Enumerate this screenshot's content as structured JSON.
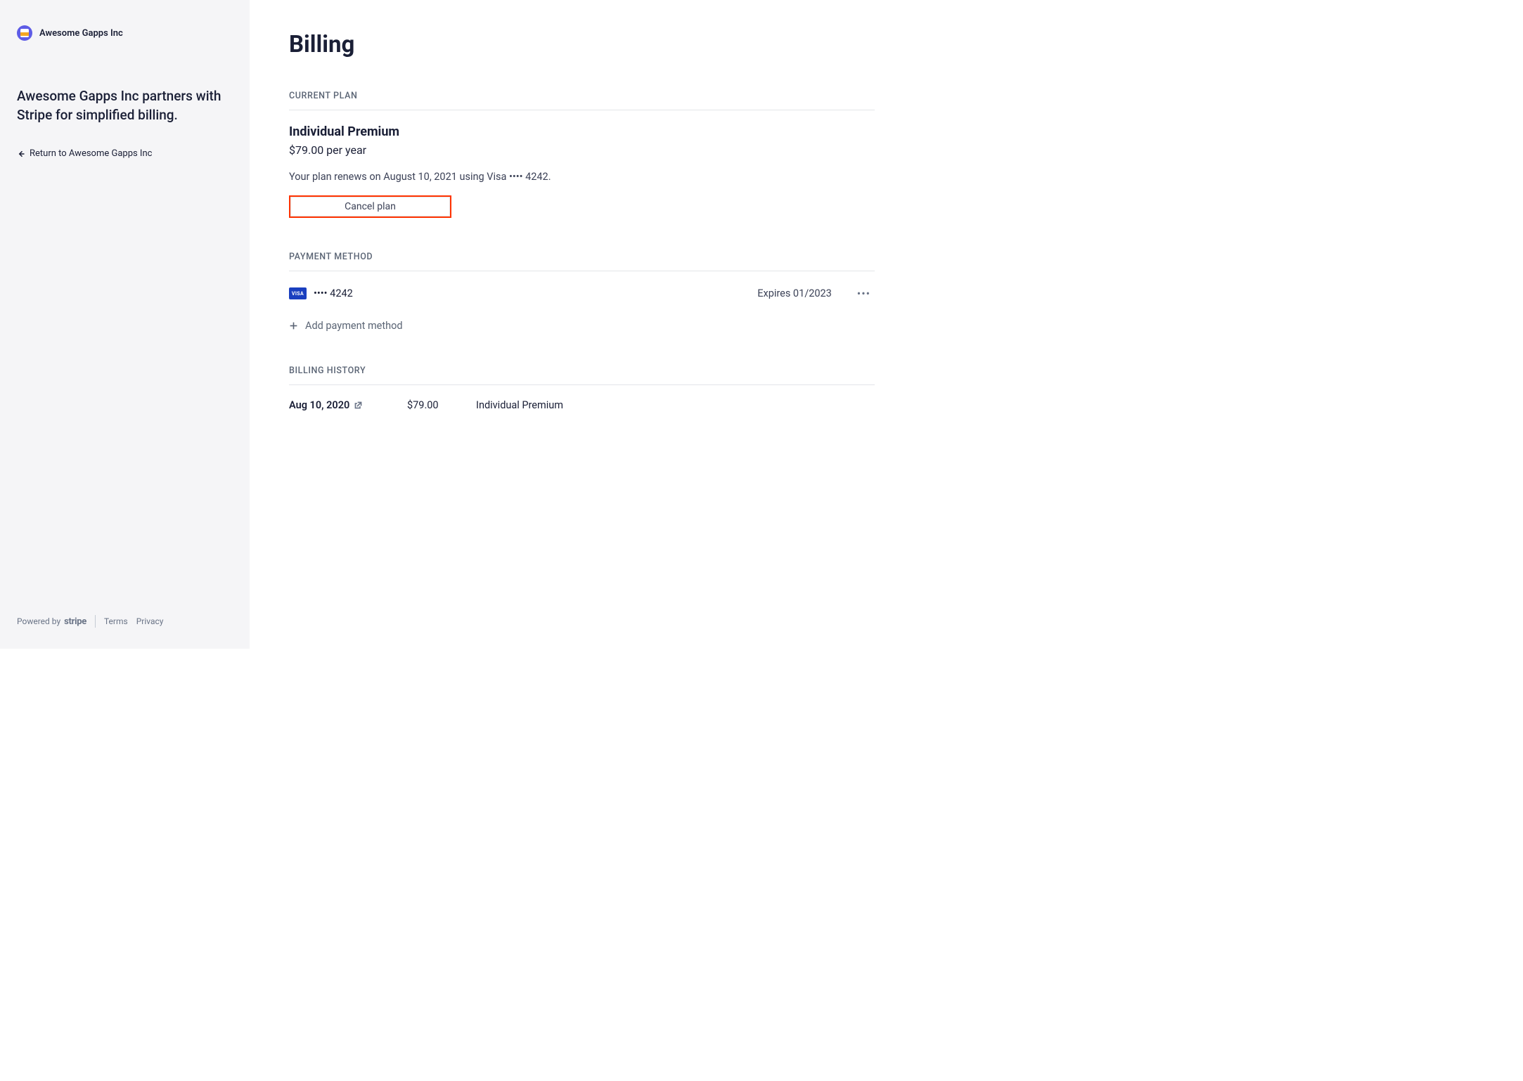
{
  "sidebar": {
    "brand_name": "Awesome Gapps Inc",
    "partner_text": "Awesome Gapps Inc partners with Stripe for simplified billing.",
    "return_link": "Return to Awesome Gapps Inc",
    "footer": {
      "powered_by": "Powered by",
      "stripe": "stripe",
      "terms": "Terms",
      "privacy": "Privacy"
    }
  },
  "main": {
    "title": "Billing",
    "current_plan": {
      "label": "CURRENT PLAN",
      "name": "Individual Premium",
      "price": "$79.00 per year",
      "renew_text": "Your plan renews on August 10, 2021 using Visa •••• 4242.",
      "cancel_label": "Cancel plan"
    },
    "payment_method": {
      "label": "PAYMENT METHOD",
      "card_brand": "VISA",
      "card_last4": "•••• 4242",
      "expires": "Expires 01/2023",
      "add_label": "Add payment method"
    },
    "billing_history": {
      "label": "BILLING HISTORY",
      "rows": [
        {
          "date": "Aug 10, 2020",
          "amount": "$79.00",
          "desc": "Individual Premium"
        }
      ]
    }
  }
}
